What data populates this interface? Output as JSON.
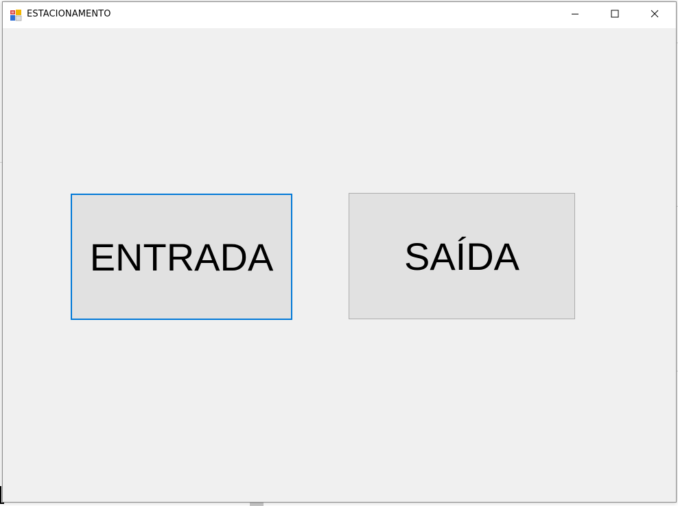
{
  "window": {
    "title": "ESTACIONAMENTO",
    "app_icon": "winforms-app-icon",
    "controls": {
      "minimize_icon": "minimize-icon",
      "maximize_icon": "maximize-icon",
      "close_icon": "close-icon"
    }
  },
  "form": {
    "entrada_label": "ENTRADA",
    "saida_label": "SAÍDA"
  },
  "colors": {
    "form_background": "#f0f0f0",
    "button_face": "#e1e1e1",
    "button_border": "#adadad",
    "focus_border": "#0078d7",
    "titlebar": "#ffffff"
  }
}
